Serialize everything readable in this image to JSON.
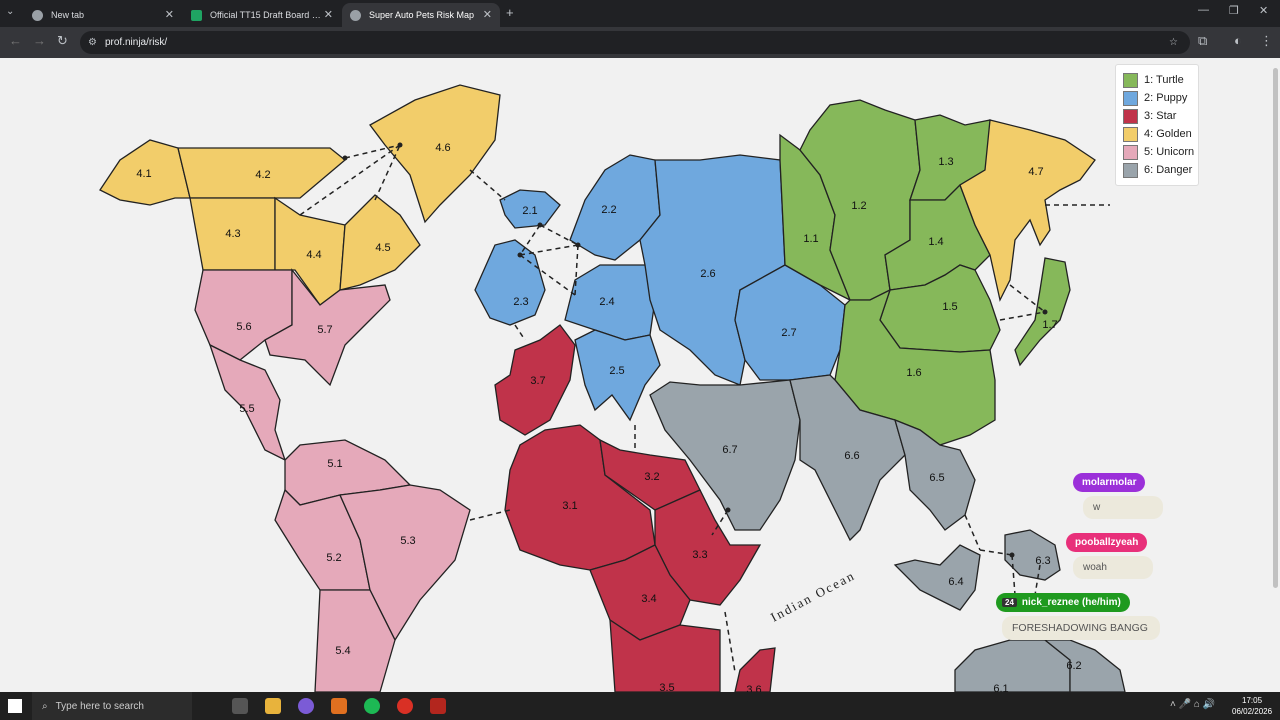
{
  "browser": {
    "tabs": [
      {
        "title": "New tab",
        "active": false
      },
      {
        "title": "Official TT15 Draft Board - Goo",
        "active": false
      },
      {
        "title": "Super Auto Pets Risk Map",
        "active": true
      }
    ],
    "url": "prof.ninja/risk/"
  },
  "legend": [
    {
      "label": "1: Turtle",
      "color": "#86b85a"
    },
    {
      "label": "2: Puppy",
      "color": "#6fa8de"
    },
    {
      "label": "3: Star",
      "color": "#c0334a"
    },
    {
      "label": "4: Golden",
      "color": "#f2cd6a"
    },
    {
      "label": "5: Unicorn",
      "color": "#e5a9ba"
    },
    {
      "label": "6: Danger",
      "color": "#9aa4ab"
    }
  ],
  "map": {
    "ocean_label": "Indian Ocean",
    "territories": {
      "t4_1": "4.1",
      "t4_2": "4.2",
      "t4_3": "4.3",
      "t4_4": "4.4",
      "t4_5": "4.5",
      "t4_6": "4.6",
      "t4_7": "4.7",
      "t5_1": "5.1",
      "t5_2": "5.2",
      "t5_3": "5.3",
      "t5_4": "5.4",
      "t5_5": "5.5",
      "t5_6": "5.6",
      "t5_7": "5.7",
      "t2_1": "2.1",
      "t2_2": "2.2",
      "t2_3": "2.3",
      "t2_4": "2.4",
      "t2_5": "2.5",
      "t2_6": "2.6",
      "t2_7": "2.7",
      "t1_1": "1.1",
      "t1_2": "1.2",
      "t1_3": "1.3",
      "t1_4": "1.4",
      "t1_5": "1.5",
      "t1_6": "1.6",
      "t1_7": "1.7",
      "t3_1": "3.1",
      "t3_2": "3.2",
      "t3_3": "3.3",
      "t3_4": "3.4",
      "t3_5": "3.5",
      "t3_6": "3.6",
      "t3_7": "3.7",
      "t6_1": "6.1",
      "t6_2": "6.2",
      "t6_3": "6.3",
      "t6_4": "6.4",
      "t6_5": "6.5",
      "t6_6": "6.6",
      "t6_7": "6.7"
    }
  },
  "chat": [
    {
      "user": "molarmolar",
      "message": "w",
      "color": "#9b30d9"
    },
    {
      "user": "pooballzyeah",
      "message": "woah",
      "color": "#e8307a"
    },
    {
      "user": "nick_reznee (he/him)",
      "message": "FORESHADOWING BANGG",
      "color": "#1f9a1f",
      "badge": "24"
    }
  ],
  "taskbar": {
    "search_placeholder": "Type here to search",
    "time": "17:05",
    "date": "06/02/2026"
  }
}
